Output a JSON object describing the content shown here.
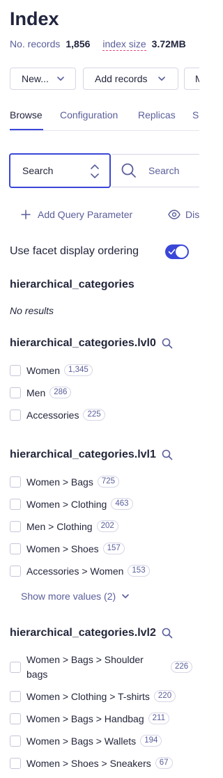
{
  "header": {
    "title": "Index",
    "records_label": "No. records",
    "records_value": "1,856",
    "size_label": "index size",
    "size_value": "3.72MB"
  },
  "toolbar": {
    "new_label": "New...",
    "add_records_label": "Add records",
    "more_label": "M"
  },
  "tabs": [
    {
      "label": "Browse",
      "active": true
    },
    {
      "label": "Configuration",
      "active": false
    },
    {
      "label": "Replicas",
      "active": false
    },
    {
      "label": "Se",
      "active": false
    }
  ],
  "search": {
    "mode_value": "Search",
    "placeholder": "Search"
  },
  "query": {
    "add_param_label": "Add Query Parameter",
    "display_label": "Dis"
  },
  "facet_ordering": {
    "label": "Use facet display ordering",
    "enabled": true
  },
  "facets": [
    {
      "name": "hierarchical_categories",
      "empty_text": "No results"
    },
    {
      "name": "hierarchical_categories.lvl0",
      "items": [
        {
          "label": "Women",
          "count": "1,345"
        },
        {
          "label": "Men",
          "count": "286"
        },
        {
          "label": "Accessories",
          "count": "225"
        }
      ]
    },
    {
      "name": "hierarchical_categories.lvl1",
      "items": [
        {
          "label": "Women > Bags",
          "count": "725"
        },
        {
          "label": "Women > Clothing",
          "count": "463"
        },
        {
          "label": "Men > Clothing",
          "count": "202"
        },
        {
          "label": "Women > Shoes",
          "count": "157"
        },
        {
          "label": "Accessories > Women",
          "count": "153"
        }
      ],
      "show_more_label": "Show more values (2)"
    },
    {
      "name": "hierarchical_categories.lvl2",
      "items": [
        {
          "label": "Women > Bags > Shoulder bags",
          "count": "226"
        },
        {
          "label": "Women > Clothing > T-shirts",
          "count": "220"
        },
        {
          "label": "Women > Bags > Handbag",
          "count": "211"
        },
        {
          "label": "Women > Bags > Wallets",
          "count": "194"
        },
        {
          "label": "Women > Shoes > Sneakers",
          "count": "67"
        }
      ]
    }
  ],
  "colors": {
    "accent": "#3a46d8",
    "text": "#23263b",
    "muted": "#5a5e9a",
    "border": "#d6d6e7",
    "dashed_underline": "#e8487c"
  },
  "icons": {
    "chevron": "chevron-down-icon",
    "sort": "sort-updown-icon",
    "search": "search-icon",
    "plus": "plus-icon",
    "eye": "eye-icon",
    "check": "check-icon"
  }
}
